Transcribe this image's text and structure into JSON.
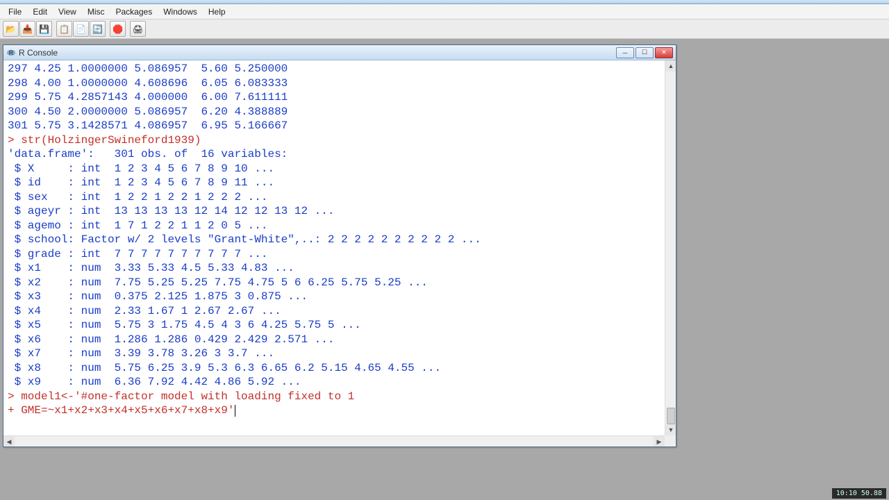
{
  "menu": {
    "items": [
      "File",
      "Edit",
      "View",
      "Misc",
      "Packages",
      "Windows",
      "Help"
    ]
  },
  "toolbar": {
    "buttons": [
      {
        "name": "open-script-icon",
        "glyph": "📂"
      },
      {
        "name": "load-workspace-icon",
        "glyph": "📥"
      },
      {
        "name": "save-workspace-icon",
        "glyph": "💾"
      },
      {
        "sep": true
      },
      {
        "name": "copy-icon",
        "glyph": "📋"
      },
      {
        "name": "paste-icon",
        "glyph": "📄"
      },
      {
        "name": "refresh-icon",
        "glyph": "🔄"
      },
      {
        "sep": true
      },
      {
        "name": "stop-icon",
        "glyph": "🛑"
      },
      {
        "sep": true
      },
      {
        "name": "print-icon",
        "glyph": "🖨"
      }
    ]
  },
  "child_window": {
    "title": "R Console",
    "icon": "R"
  },
  "console": {
    "lines": [
      {
        "c": "blue",
        "t": "297 4.25 1.0000000 5.086957  5.60 5.250000"
      },
      {
        "c": "blue",
        "t": "298 4.00 1.0000000 4.608696  6.05 6.083333"
      },
      {
        "c": "blue",
        "t": "299 5.75 4.2857143 4.000000  6.00 7.611111"
      },
      {
        "c": "blue",
        "t": "300 4.50 2.0000000 5.086957  6.20 4.388889"
      },
      {
        "c": "blue",
        "t": "301 5.75 3.1428571 4.086957  6.95 5.166667"
      },
      {
        "c": "red",
        "t": "> str(HolzingerSwineford1939)"
      },
      {
        "c": "blue",
        "t": "'data.frame':   301 obs. of  16 variables:"
      },
      {
        "c": "blue",
        "t": " $ X     : int  1 2 3 4 5 6 7 8 9 10 ..."
      },
      {
        "c": "blue",
        "t": " $ id    : int  1 2 3 4 5 6 7 8 9 11 ..."
      },
      {
        "c": "blue",
        "t": " $ sex   : int  1 2 2 1 2 2 1 2 2 2 ..."
      },
      {
        "c": "blue",
        "t": " $ ageyr : int  13 13 13 13 12 14 12 12 13 12 ..."
      },
      {
        "c": "blue",
        "t": " $ agemo : int  1 7 1 2 2 1 1 2 0 5 ..."
      },
      {
        "c": "blue",
        "t": " $ school: Factor w/ 2 levels \"Grant-White\",..: 2 2 2 2 2 2 2 2 2 2 ..."
      },
      {
        "c": "blue",
        "t": " $ grade : int  7 7 7 7 7 7 7 7 7 7 ..."
      },
      {
        "c": "blue",
        "t": " $ x1    : num  3.33 5.33 4.5 5.33 4.83 ..."
      },
      {
        "c": "blue",
        "t": " $ x2    : num  7.75 5.25 5.25 7.75 4.75 5 6 6.25 5.75 5.25 ..."
      },
      {
        "c": "blue",
        "t": " $ x3    : num  0.375 2.125 1.875 3 0.875 ..."
      },
      {
        "c": "blue",
        "t": " $ x4    : num  2.33 1.67 1 2.67 2.67 ..."
      },
      {
        "c": "blue",
        "t": " $ x5    : num  5.75 3 1.75 4.5 4 3 6 4.25 5.75 5 ..."
      },
      {
        "c": "blue",
        "t": " $ x6    : num  1.286 1.286 0.429 2.429 2.571 ..."
      },
      {
        "c": "blue",
        "t": " $ x7    : num  3.39 3.78 3.26 3 3.7 ..."
      },
      {
        "c": "blue",
        "t": " $ x8    : num  5.75 6.25 3.9 5.3 6.3 6.65 6.2 5.15 4.65 4.55 ..."
      },
      {
        "c": "blue",
        "t": " $ x9    : num  6.36 7.92 4.42 4.86 5.92 ..."
      },
      {
        "c": "red",
        "t": "> model1<-'#one-factor model with loading fixed to 1"
      },
      {
        "c": "red",
        "t": "+ GME=~x1+x2+x3+x4+x5+x6+x7+x8+x9'",
        "cursor": true
      }
    ]
  },
  "clock": "10:10  50.88"
}
